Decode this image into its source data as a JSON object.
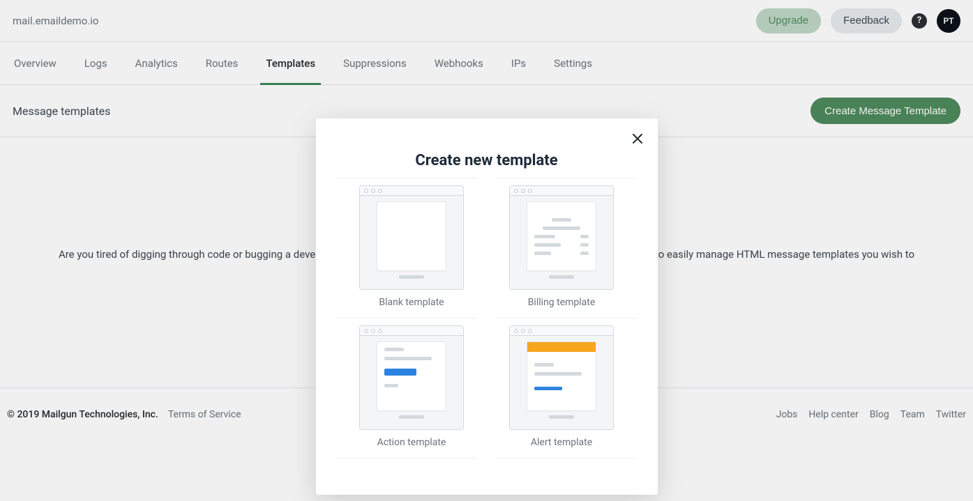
{
  "header": {
    "domain": "mail.emaildemo.io",
    "upgrade_label": "Upgrade",
    "feedback_label": "Feedback",
    "help_badge": "?",
    "avatar_initials": "PT"
  },
  "tabs": [
    {
      "label": "Overview",
      "active": false
    },
    {
      "label": "Logs",
      "active": false
    },
    {
      "label": "Analytics",
      "active": false
    },
    {
      "label": "Routes",
      "active": false
    },
    {
      "label": "Templates",
      "active": true
    },
    {
      "label": "Suppressions",
      "active": false
    },
    {
      "label": "Webhooks",
      "active": false
    },
    {
      "label": "IPs",
      "active": false
    },
    {
      "label": "Settings",
      "active": false
    }
  ],
  "section": {
    "title": "Message templates",
    "create_button": "Create Message Template"
  },
  "empty_state": {
    "text": "Are you tired of digging through code or bugging a developer just to update some copy in an email? Mailgun templates allow you to easily manage HTML message templates you wish to use. Don't delay and create a template today!"
  },
  "footer": {
    "copyright": "© 2019 Mailgun Technologies, Inc.",
    "terms": "Terms of Service",
    "links": [
      "Jobs",
      "Help center",
      "Blog",
      "Team",
      "Twitter"
    ]
  },
  "modal": {
    "title": "Create new template",
    "options": [
      {
        "name": "Blank template"
      },
      {
        "name": "Billing template"
      },
      {
        "name": "Action template"
      },
      {
        "name": "Alert template"
      }
    ]
  }
}
